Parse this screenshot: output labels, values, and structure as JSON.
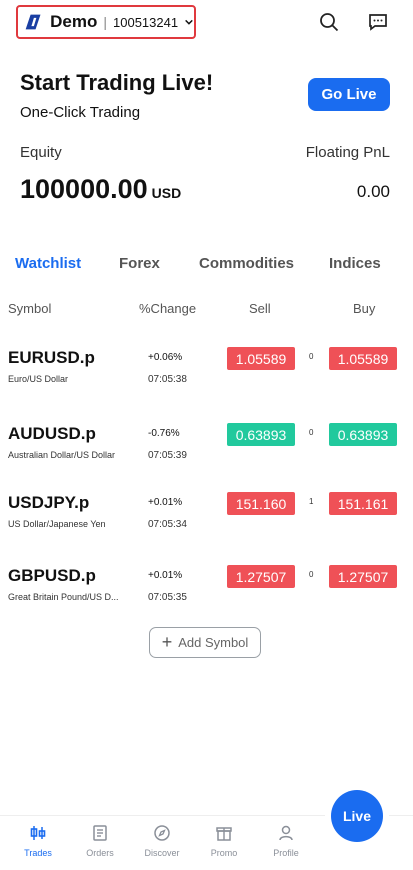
{
  "header": {
    "account_name": "Demo",
    "separator": "|",
    "account_number": "100513241"
  },
  "promo": {
    "headline": "Start Trading Live!",
    "subline": "One-Click Trading",
    "go_live_label": "Go Live"
  },
  "summary": {
    "equity_label": "Equity",
    "equity_value": "100000.00",
    "equity_currency": "USD",
    "pnl_label": "Floating PnL",
    "pnl_value": "0.00"
  },
  "tabs": [
    {
      "label": "Watchlist",
      "active": true
    },
    {
      "label": "Forex",
      "active": false
    },
    {
      "label": "Commodities",
      "active": false
    },
    {
      "label": "Indices",
      "active": false
    }
  ],
  "columns": {
    "symbol": "Symbol",
    "change": "%Change",
    "sell": "Sell",
    "buy": "Buy"
  },
  "rows": [
    {
      "symbol": "EURUSD.p",
      "desc": "Euro/US Dollar",
      "change": "+0.06%",
      "time": "07:05:38",
      "sell": "1.05589",
      "spread": "0",
      "buy": "1.05589",
      "color": "#ef5157"
    },
    {
      "symbol": "AUDUSD.p",
      "desc": "Australian Dollar/US Dollar",
      "change": "-0.76%",
      "time": "07:05:39",
      "sell": "0.63893",
      "spread": "0",
      "buy": "0.63893",
      "color": "#21c99d"
    },
    {
      "symbol": "USDJPY.p",
      "desc": "US Dollar/Japanese Yen",
      "change": "+0.01%",
      "time": "07:05:34",
      "sell": "151.160",
      "spread": "1",
      "buy": "151.161",
      "color": "#ef5157"
    },
    {
      "symbol": "GBPUSD.p",
      "desc": "Great Britain Pound/US D...",
      "change": "+0.01%",
      "time": "07:05:35",
      "sell": "1.27507",
      "spread": "0",
      "buy": "1.27507",
      "color": "#ef5157"
    }
  ],
  "add_symbol_label": "Add Symbol",
  "live_fab_label": "Live",
  "nav": [
    {
      "label": "Trades",
      "icon": "trades-icon",
      "active": true
    },
    {
      "label": "Orders",
      "icon": "orders-icon",
      "active": false
    },
    {
      "label": "Discover",
      "icon": "compass-icon",
      "active": false
    },
    {
      "label": "Promo",
      "icon": "gift-icon",
      "active": false
    },
    {
      "label": "Profile",
      "icon": "profile-icon",
      "active": false
    }
  ],
  "colors": {
    "accent": "#1a6cf0",
    "sell_red": "#ef5157",
    "buy_green": "#21c99d",
    "highlight_border": "#e0393e"
  }
}
